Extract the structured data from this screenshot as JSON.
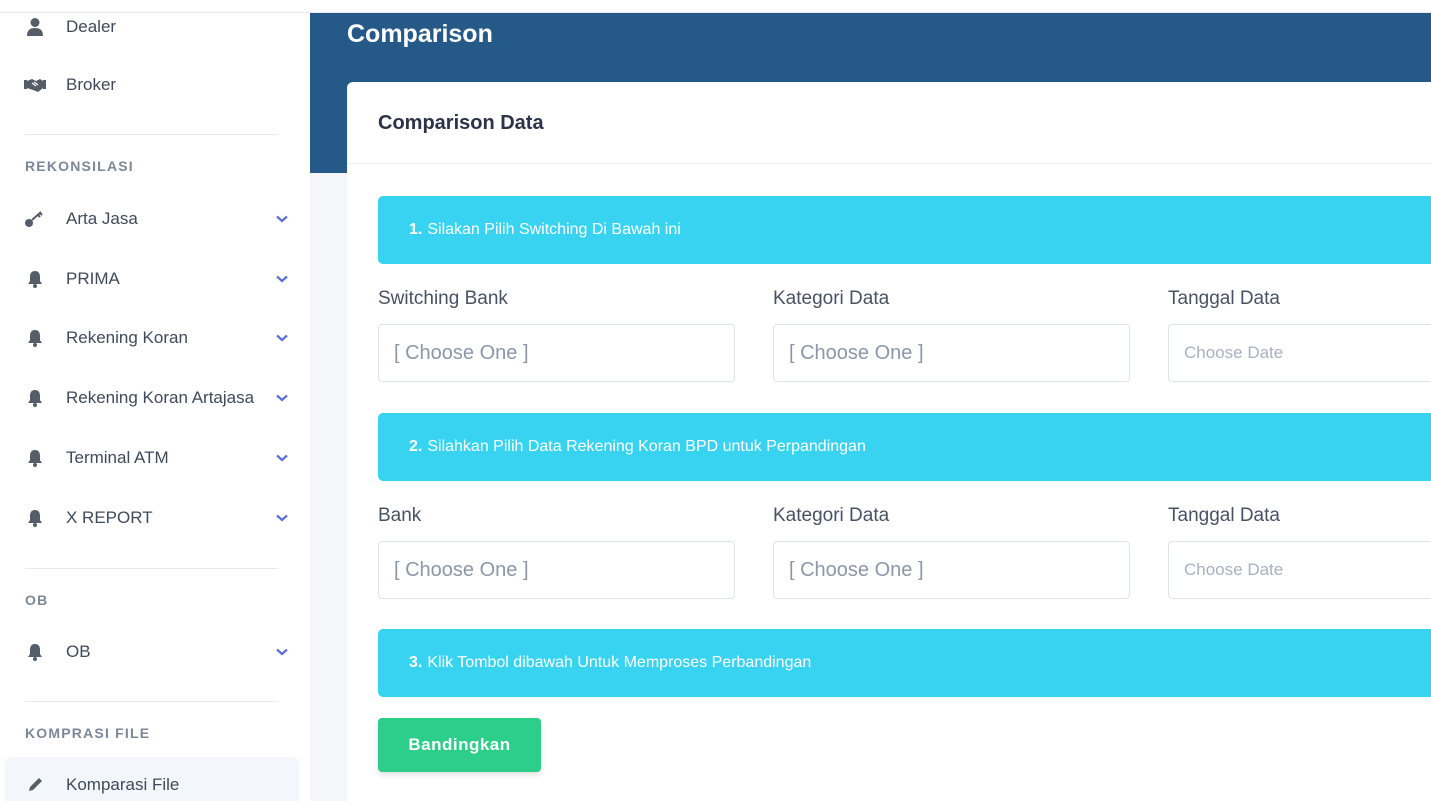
{
  "page": {
    "title": "Comparison"
  },
  "sidebar": {
    "top_items": [
      {
        "label": "Dealer",
        "icon": "user-icon"
      },
      {
        "label": "Broker",
        "icon": "handshake-icon"
      }
    ],
    "sections": [
      {
        "heading": "REKONSILASI",
        "items": [
          {
            "label": "Arta Jasa",
            "icon": "key-icon"
          },
          {
            "label": "PRIMA",
            "icon": "bell-icon"
          },
          {
            "label": "Rekening Koran",
            "icon": "bell-icon"
          },
          {
            "label": "Rekening Koran Artajasa",
            "icon": "bell-icon"
          },
          {
            "label": "Terminal ATM",
            "icon": "bell-icon"
          },
          {
            "label": "X REPORT",
            "icon": "bell-icon"
          }
        ]
      },
      {
        "heading": "OB",
        "items": [
          {
            "label": "OB",
            "icon": "bell-icon"
          }
        ]
      },
      {
        "heading": "KOMPRASI FILE",
        "items": [
          {
            "label": "Komparasi File",
            "icon": "pen-icon"
          }
        ]
      }
    ]
  },
  "card": {
    "title": "Comparison Data",
    "steps": [
      {
        "num": "1.",
        "text": "Silakan Pilih Switching Di Bawah ini"
      },
      {
        "num": "2.",
        "text": "Silahkan Pilih Data Rekening Koran BPD untuk Perpandingan"
      },
      {
        "num": "3.",
        "text": "Klik Tombol dibawah Untuk Memproses Perbandingan"
      }
    ],
    "row1": {
      "switching_bank_label": "Switching Bank",
      "switching_bank_value": "[ Choose One ]",
      "kategori_label": "Kategori Data",
      "kategori_value": "[ Choose One ]",
      "tanggal_label": "Tanggal Data",
      "tanggal_placeholder": "Choose Date"
    },
    "row2": {
      "bank_label": "Bank",
      "bank_value": "[ Choose One ]",
      "kategori_label": "Kategori Data",
      "kategori_value": "[ Choose One ]",
      "tanggal_label": "Tanggal Data",
      "tanggal_placeholder": "Choose Date"
    },
    "submit_label": "Bandingkan"
  },
  "colors": {
    "header_blue": "#255988",
    "step_cyan": "#39d3f2",
    "button_green": "#2dce89",
    "chevron_blue": "#5a6fd6"
  }
}
